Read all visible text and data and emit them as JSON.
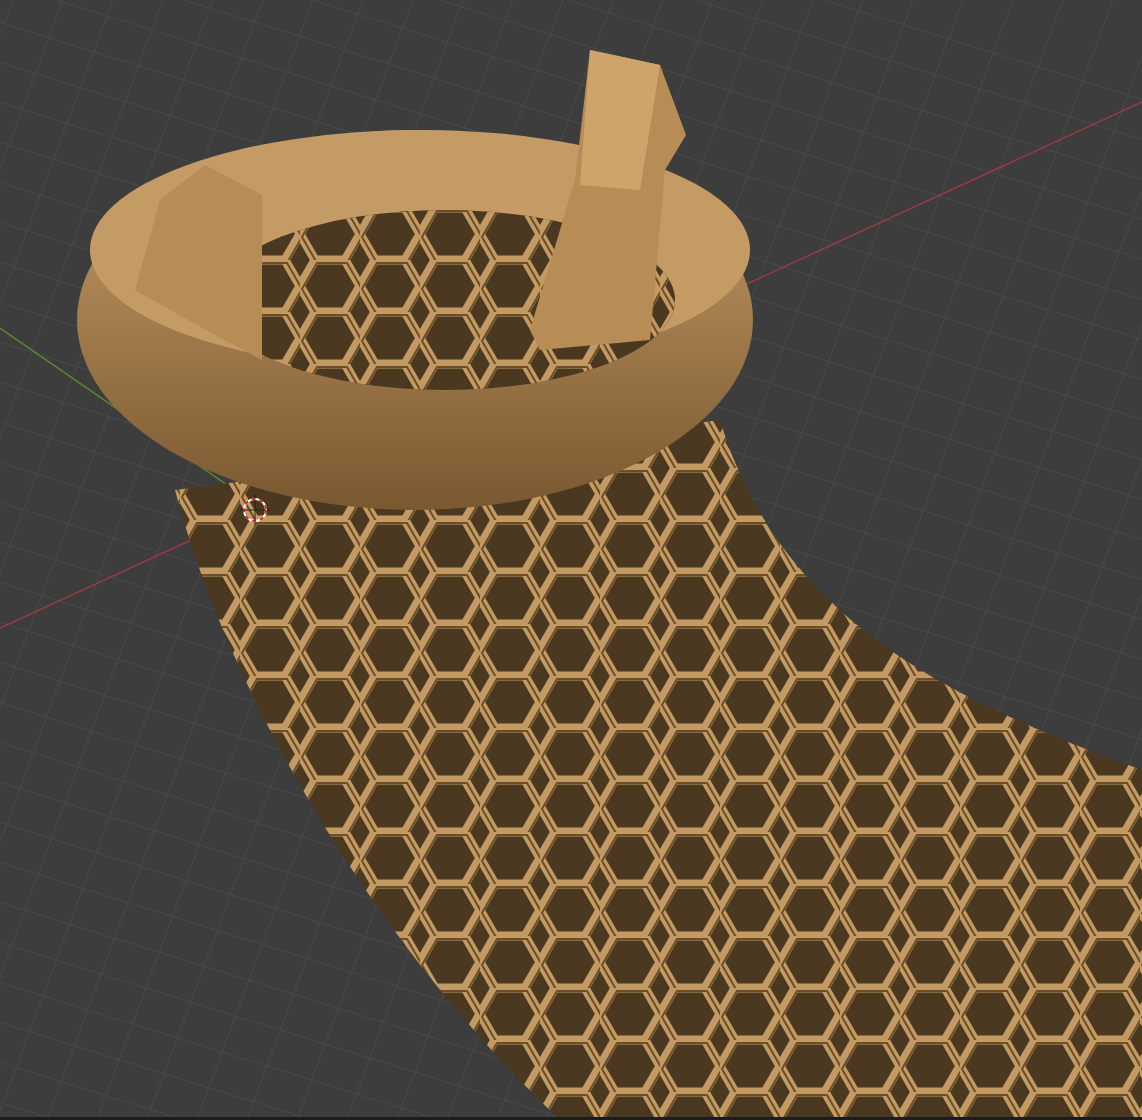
{
  "viewport": {
    "show_grid": true,
    "show_axes": true,
    "show_cursor": true
  }
}
